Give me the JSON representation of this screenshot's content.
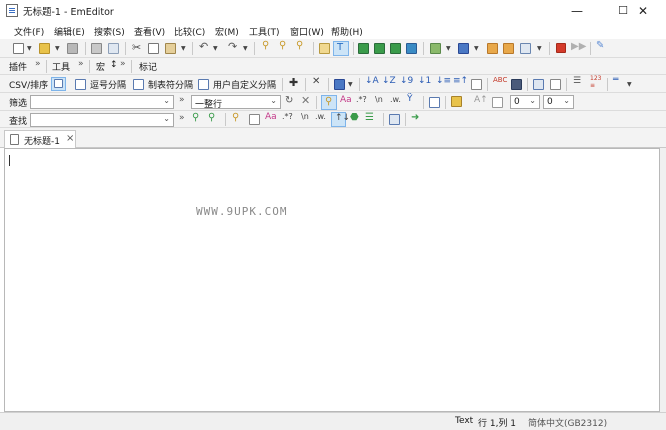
{
  "window": {
    "title": "无标题-1 - EmEditor",
    "minimize": "—",
    "maximize": "☐",
    "close": "✕"
  },
  "menu": [
    "文件(F)",
    "编辑(E)",
    "搜索(S)",
    "查看(V)",
    "比较(C)",
    "宏(M)",
    "工具(T)",
    "窗口(W)",
    "帮助(H)"
  ],
  "toolbar_row2": {
    "plugins": "插件",
    "tools": "工具",
    "macro": "宏",
    "macro_suffix": "↕",
    "bookmark": "标记",
    "chevron": "»"
  },
  "toolbar_row3": {
    "csv": "CSV/排序",
    "comma": "逗号分隔",
    "tab": "制表符分隔",
    "custom": "用户自定义分隔"
  },
  "filter_bar": {
    "label": "筛选",
    "input_value": "",
    "mode_value": "一整行",
    "chevron": "»",
    "num1": "0",
    "num2": "0"
  },
  "find_bar": {
    "label": "查找",
    "input_value": "",
    "chevron": "»"
  },
  "tab": {
    "label": "无标题-1",
    "close": "×"
  },
  "editor": {
    "watermark": "WWW.9UPK.COM"
  },
  "status": {
    "mode": "Text",
    "position": "行 1,列 1",
    "encoding_partial": "简体中文(GB2312)"
  }
}
